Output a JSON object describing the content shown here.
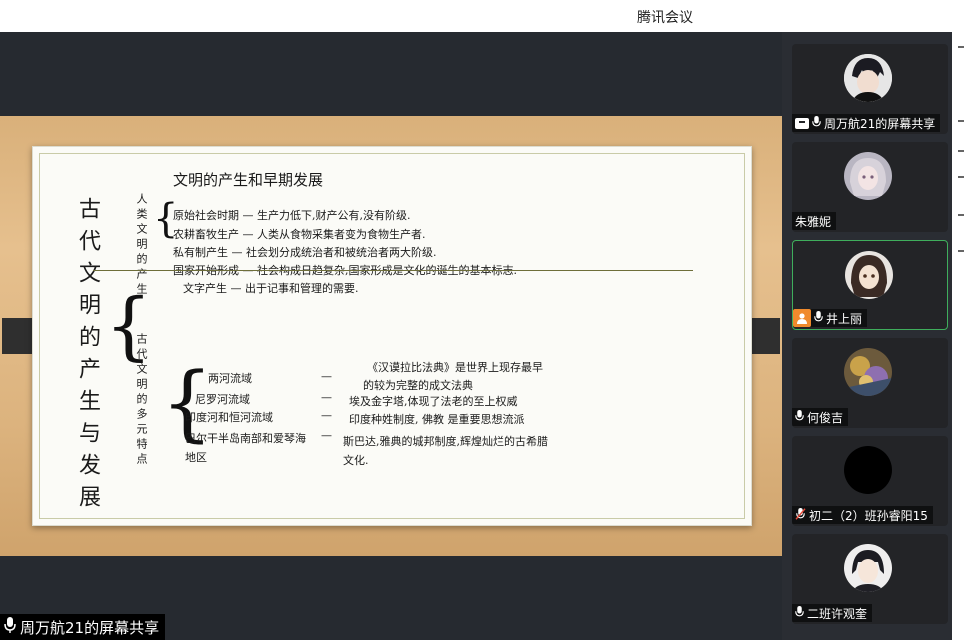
{
  "app": {
    "title": "腾讯会议"
  },
  "shared_screen": {
    "owner_label": "周万航21的屏幕共享",
    "board": {
      "heading": "文明的产生和早期发展",
      "main_title": "古代文明的产生与发展",
      "group1_label": "人类文明的产生",
      "group1_items": [
        "原始社会时期 — 生产力低下,财产公有,没有阶级.",
        "农耕畜牧生产 — 人类从食物采集者变为食物生产者.",
        "私有制产生 — 社会划分成统治者和被统治者两大阶级.",
        "国家开始形成 — 社会构成日趋复杂,国家形成是文化的诞生的基本标志.",
        "文字产生 — 出于记事和管理的需要."
      ],
      "group2_label": "古代文明的多元特点",
      "group2_regions": [
        "两河流域",
        "尼罗河流域",
        "印度河和恒河流域",
        "巴尔干半岛南部和爱琴海地区"
      ],
      "group2_dashes": [
        "—",
        "—",
        "—",
        "—"
      ],
      "group2_notes": [
        "《汉谟拉比法典》是世界上现存最早",
        "的较为完整的成文法典",
        "埃及金字塔,体现了法老的至上权威",
        "印度种姓制度, 佛教 是重要思想流派",
        "斯巴达,雅典的城邦制度,辉煌灿烂的古希腊",
        "文化."
      ]
    }
  },
  "participants": [
    {
      "name": "周万航21的屏幕共享",
      "icon": "screen-share-icon"
    },
    {
      "name": "朱雅妮"
    },
    {
      "name": "井上丽",
      "icon": "user-icon"
    },
    {
      "name": "何俊吉"
    },
    {
      "name": "初二（2）班孙睿阳15",
      "muted": true
    },
    {
      "name": "二班许观奎"
    }
  ]
}
